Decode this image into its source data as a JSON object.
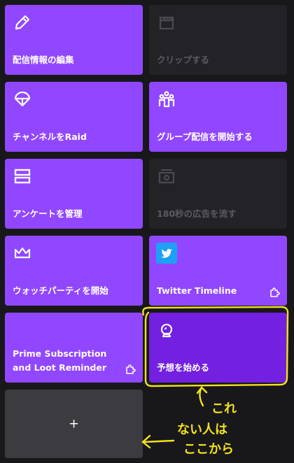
{
  "tiles": {
    "edit_info": {
      "label": "配信情報の編集",
      "state": "enabled",
      "icon": "pencil-icon"
    },
    "clip": {
      "label": "クリップする",
      "state": "disabled",
      "icon": "clapperboard-icon"
    },
    "raid": {
      "label": "チャンネルをRaid",
      "state": "enabled",
      "icon": "parachute-icon"
    },
    "group_stream": {
      "label": "グループ配信を開始する",
      "state": "enabled",
      "icon": "group-icon"
    },
    "poll": {
      "label": "アンケートを管理",
      "state": "enabled",
      "icon": "poll-icon"
    },
    "ad": {
      "label": "180秒の広告を流す",
      "state": "disabled",
      "icon": "ad-icon"
    },
    "watch_party": {
      "label": "ウォッチパーティを開始",
      "state": "enabled",
      "icon": "crown-icon"
    },
    "twitter": {
      "label": "Twitter Timeline",
      "state": "enabled",
      "icon": "twitter-bird-icon"
    },
    "prime": {
      "label": "Prime Subscription and Loot Reminder",
      "state": "enabled",
      "icon": "extension-icon"
    },
    "prediction": {
      "label": "予想を始める",
      "state": "highlighted",
      "icon": "prediction-icon"
    },
    "add": {
      "label": "+",
      "state": "enabled"
    }
  },
  "annotations": {
    "kore": "これ",
    "nai_hito": "ない人は",
    "kokokara": "ここから",
    "color": "#f2e21c"
  },
  "colors": {
    "background": "#18181b",
    "tile_purple": "#9147ff",
    "tile_prediction": "#7320e0",
    "tile_disabled": "#232327",
    "tile_add": "#3c3c40"
  }
}
